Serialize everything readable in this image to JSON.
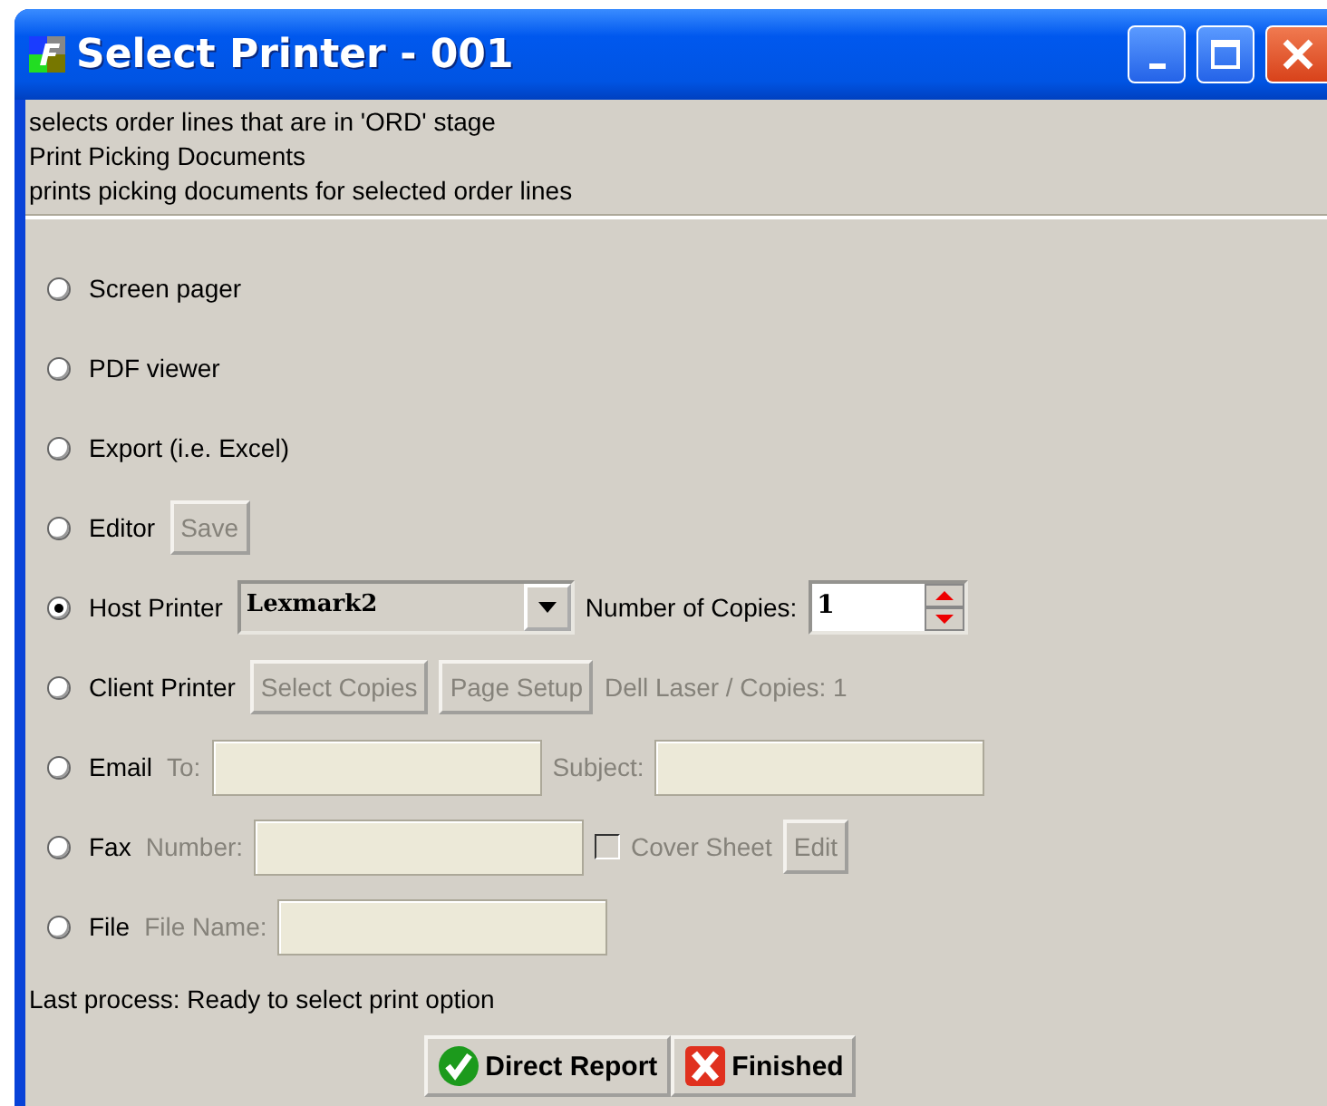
{
  "window": {
    "title": "Select Printer - 001"
  },
  "description": [
    "selects order lines that are in 'ORD' stage",
    "Print Picking Documents",
    "prints picking documents for selected order lines"
  ],
  "options": [
    {
      "label": "Screen pager",
      "selected": false
    },
    {
      "label": "PDF viewer",
      "selected": false
    },
    {
      "label": "Export (i.e. Excel)",
      "selected": false
    },
    {
      "label": "Editor",
      "selected": false,
      "controls": [
        {
          "kind": "button",
          "label": "Save",
          "disabled": true
        }
      ]
    },
    {
      "label": "Host Printer",
      "selected": true,
      "controls": [
        {
          "kind": "dropdown",
          "value": "Lexmark2"
        },
        {
          "kind": "label",
          "text": "Number of Copies:",
          "disabled": false
        },
        {
          "kind": "spinner",
          "value": "1"
        }
      ]
    },
    {
      "label": "Client Printer",
      "selected": false,
      "controls": [
        {
          "kind": "button",
          "label": "Select Copies",
          "disabled": true
        },
        {
          "kind": "button",
          "label": "Page Setup",
          "disabled": true
        },
        {
          "kind": "label",
          "text": "Dell Laser  / Copies: 1",
          "disabled": true
        }
      ]
    },
    {
      "label": "Email",
      "selected": false,
      "controls": [
        {
          "kind": "label",
          "text": "To:",
          "disabled": true
        },
        {
          "kind": "field",
          "disabled": true
        },
        {
          "kind": "label",
          "text": "Subject:",
          "disabled": true
        },
        {
          "kind": "field",
          "disabled": true
        }
      ]
    },
    {
      "label": "Fax",
      "selected": false,
      "controls": [
        {
          "kind": "label",
          "text": "Number:",
          "disabled": true
        },
        {
          "kind": "field",
          "disabled": true
        },
        {
          "kind": "checkbox",
          "label": "Cover Sheet",
          "checked": false,
          "disabled": true
        },
        {
          "kind": "button",
          "label": "Edit",
          "disabled": true
        }
      ]
    },
    {
      "label": "File",
      "selected": false,
      "controls": [
        {
          "kind": "label",
          "text": "File Name:",
          "disabled": true
        },
        {
          "kind": "field",
          "disabled": true
        }
      ]
    }
  ],
  "status": "Last process: Ready to select print option",
  "buttons": [
    {
      "kind": "ok",
      "label": "Direct Report"
    },
    {
      "kind": "cancel",
      "label": "Finished"
    }
  ]
}
